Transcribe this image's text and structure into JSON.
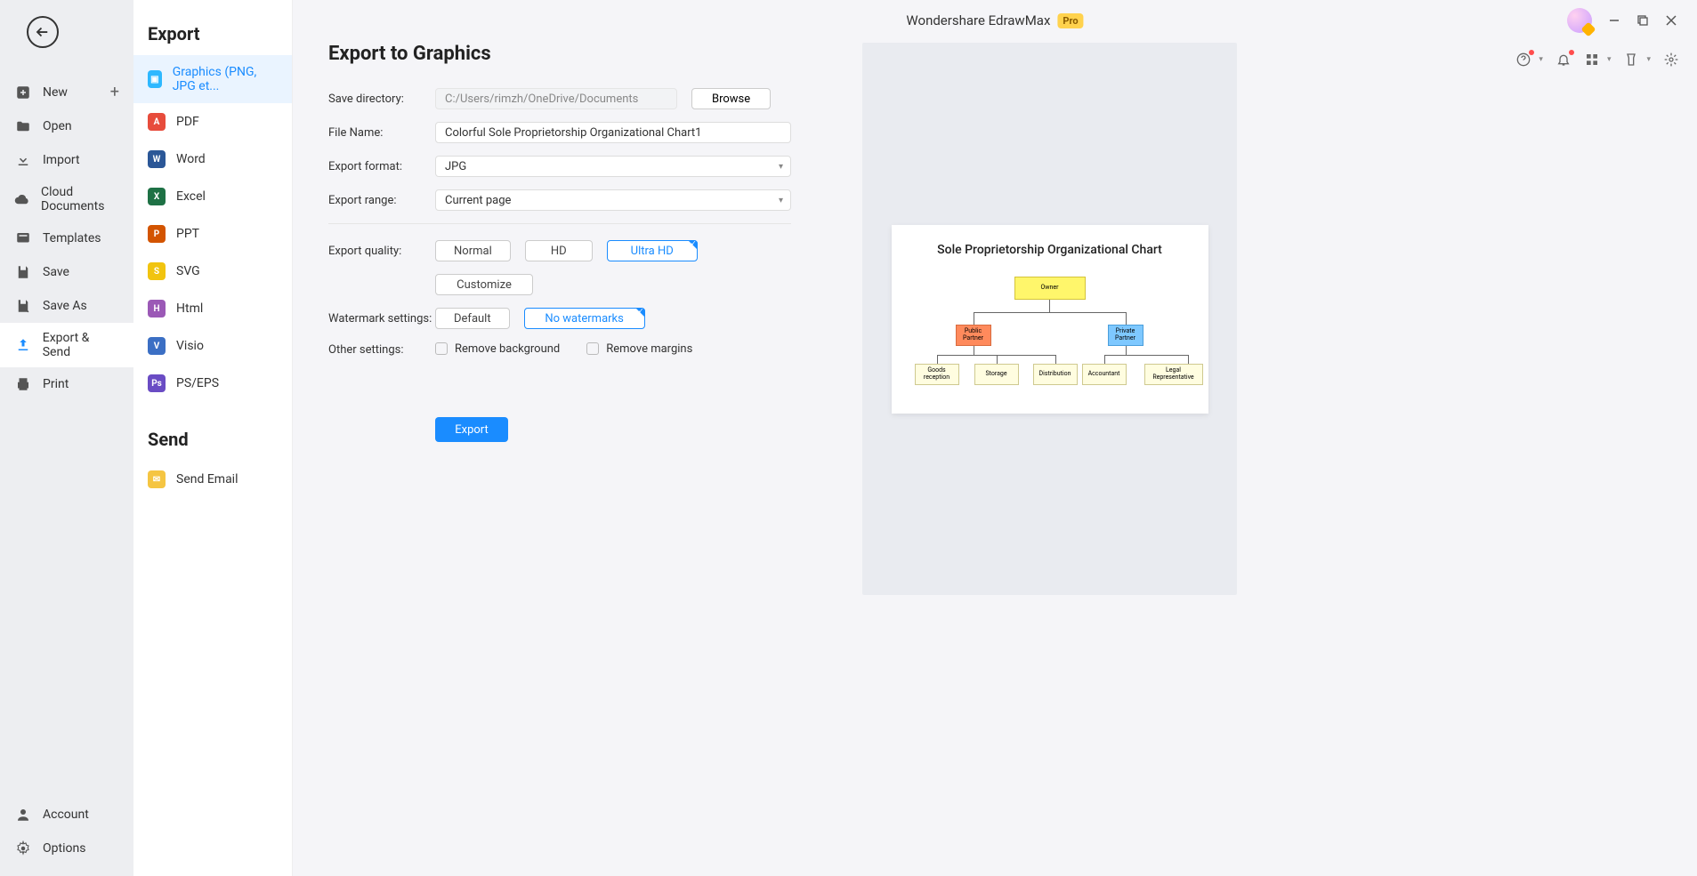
{
  "app": {
    "title": "Wondershare EdrawMax",
    "pro_badge": "Pro"
  },
  "nav": {
    "new": "New",
    "open": "Open",
    "import": "Import",
    "cloud": "Cloud Documents",
    "templates": "Templates",
    "save": "Save",
    "save_as": "Save As",
    "export_send": "Export & Send",
    "print": "Print",
    "account": "Account",
    "options": "Options"
  },
  "types": {
    "export_heading": "Export",
    "items": {
      "graphics": "Graphics (PNG, JPG et...",
      "pdf": "PDF",
      "word": "Word",
      "excel": "Excel",
      "ppt": "PPT",
      "svg": "SVG",
      "html": "Html",
      "visio": "Visio",
      "pseps": "PS/EPS"
    },
    "send_heading": "Send",
    "send_email": "Send Email"
  },
  "form": {
    "heading": "Export to Graphics",
    "save_dir_label": "Save directory:",
    "save_dir_value": "C:/Users/rimzh/OneDrive/Documents",
    "browse": "Browse",
    "file_name_label": "File Name:",
    "file_name_value": "Colorful Sole Proprietorship Organizational Chart1",
    "format_label": "Export format:",
    "format_value": "JPG",
    "range_label": "Export range:",
    "range_value": "Current page",
    "quality_label": "Export quality:",
    "quality_normal": "Normal",
    "quality_hd": "HD",
    "quality_ultra": "Ultra HD",
    "customize": "Customize",
    "watermark_label": "Watermark settings:",
    "watermark_default": "Default",
    "watermark_none": "No watermarks",
    "other_label": "Other settings:",
    "remove_bg": "Remove background",
    "remove_margins": "Remove margins",
    "export_btn": "Export"
  },
  "preview": {
    "title": "Sole Proprietorship Organizational Chart",
    "owner": "Owner",
    "public_partner": "Public Partner",
    "private_partner": "Private Partner",
    "goods": "Goods reception",
    "storage": "Storage",
    "distribution": "Distribution",
    "accountant": "Accountant",
    "legal": "Legal Representative"
  }
}
